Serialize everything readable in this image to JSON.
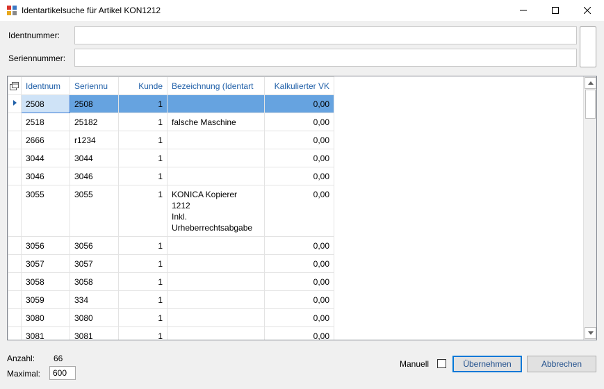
{
  "window": {
    "title": "Identartikelsuche für Artikel KON1212"
  },
  "form": {
    "identnummer_label": "Identnummer:",
    "identnummer_value": "",
    "seriennummer_label": "Seriennummer:",
    "seriennummer_value": ""
  },
  "grid": {
    "columns": [
      "Identnum",
      "Seriennu",
      "Kunde",
      "Bezeichnung (Identart",
      "Kalkulierter VK"
    ],
    "rows": [
      {
        "ident": "2508",
        "serien": "2508",
        "kunde": "1",
        "bez": "",
        "vk": "0,00",
        "selected": true
      },
      {
        "ident": "2518",
        "serien": "25182",
        "kunde": "1",
        "bez": "falsche Maschine",
        "vk": "0,00"
      },
      {
        "ident": "2666",
        "serien": "r1234",
        "kunde": "1",
        "bez": "",
        "vk": "0,00"
      },
      {
        "ident": "3044",
        "serien": "3044",
        "kunde": "1",
        "bez": "",
        "vk": "0,00"
      },
      {
        "ident": "3046",
        "serien": "3046",
        "kunde": "1",
        "bez": "",
        "vk": "0,00"
      },
      {
        "ident": "3055",
        "serien": "3055",
        "kunde": "1",
        "bez_lines": [
          "KONICA Kopierer",
          "1212",
          "Inkl.",
          "Urheberrechtsabgabe"
        ],
        "vk": "0,00"
      },
      {
        "ident": "3056",
        "serien": "3056",
        "kunde": "1",
        "bez": "",
        "vk": "0,00"
      },
      {
        "ident": "3057",
        "serien": "3057",
        "kunde": "1",
        "bez": "",
        "vk": "0,00"
      },
      {
        "ident": "3058",
        "serien": "3058",
        "kunde": "1",
        "bez": "",
        "vk": "0,00"
      },
      {
        "ident": "3059",
        "serien": "334",
        "kunde": "1",
        "bez": "",
        "vk": "0,00"
      },
      {
        "ident": "3080",
        "serien": "3080",
        "kunde": "1",
        "bez": "",
        "vk": "0,00"
      },
      {
        "ident": "3081",
        "serien": "3081",
        "kunde": "1",
        "bez": "",
        "vk": "0,00"
      }
    ]
  },
  "footer": {
    "anzahl_label": "Anzahl:",
    "anzahl_value": "66",
    "maximal_label": "Maximal:",
    "maximal_value": "600",
    "manuell_label": "Manuell",
    "manuell_checked": false,
    "uebernehmen_label": "Übernehmen",
    "abbrechen_label": "Abbrechen"
  },
  "colors": {
    "selection": "#66a3e0",
    "header_text": "#1f5fa8",
    "default_button_border": "#0078d7"
  },
  "icons": {
    "app": "app-icon",
    "minimize": "minimize-icon",
    "maximize": "maximize-icon",
    "close": "close-icon",
    "row_pointer": "row-pointer-icon",
    "column_chooser": "column-chooser-icon"
  }
}
